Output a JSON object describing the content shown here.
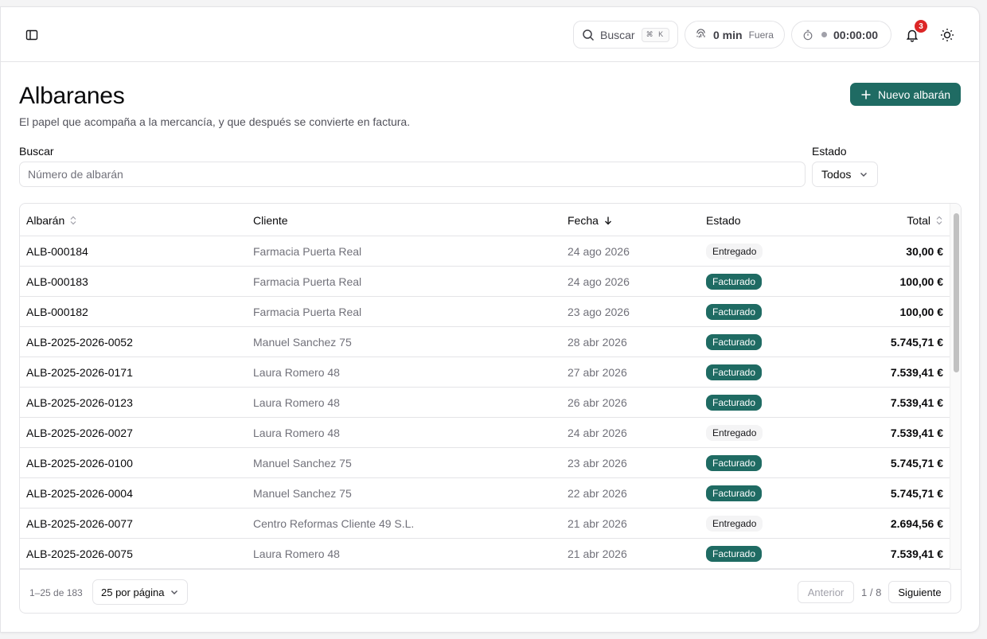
{
  "topbar": {
    "search_label": "Buscar",
    "search_shortcut": "⌘ K",
    "time_value": "0 min",
    "time_status": "Fuera",
    "timer_value": "00:00:00",
    "notifications_count": "3"
  },
  "page": {
    "title": "Albaranes",
    "subtitle": "El papel que acompaña a la mercancía, y que después se convierte en factura.",
    "new_button": "Nuevo albarán"
  },
  "filters": {
    "search_label": "Buscar",
    "search_placeholder": "Número de albarán",
    "estado_label": "Estado",
    "estado_value": "Todos"
  },
  "table": {
    "columns": {
      "albaran": "Albarán",
      "cliente": "Cliente",
      "fecha": "Fecha",
      "estado": "Estado",
      "total": "Total"
    },
    "rows": [
      {
        "id": "ALB-000184",
        "cliente": "Farmacia Puerta Real",
        "fecha": "24 ago 2026",
        "estado": "Entregado",
        "total": "30,00 €"
      },
      {
        "id": "ALB-000183",
        "cliente": "Farmacia Puerta Real",
        "fecha": "24 ago 2026",
        "estado": "Facturado",
        "total": "100,00 €"
      },
      {
        "id": "ALB-000182",
        "cliente": "Farmacia Puerta Real",
        "fecha": "23 ago 2026",
        "estado": "Facturado",
        "total": "100,00 €"
      },
      {
        "id": "ALB-2025-2026-0052",
        "cliente": "Manuel Sanchez 75",
        "fecha": "28 abr 2026",
        "estado": "Facturado",
        "total": "5.745,71 €"
      },
      {
        "id": "ALB-2025-2026-0171",
        "cliente": "Laura Romero 48",
        "fecha": "27 abr 2026",
        "estado": "Facturado",
        "total": "7.539,41 €"
      },
      {
        "id": "ALB-2025-2026-0123",
        "cliente": "Laura Romero 48",
        "fecha": "26 abr 2026",
        "estado": "Facturado",
        "total": "7.539,41 €"
      },
      {
        "id": "ALB-2025-2026-0027",
        "cliente": "Laura Romero 48",
        "fecha": "24 abr 2026",
        "estado": "Entregado",
        "total": "7.539,41 €"
      },
      {
        "id": "ALB-2025-2026-0100",
        "cliente": "Manuel Sanchez 75",
        "fecha": "23 abr 2026",
        "estado": "Facturado",
        "total": "5.745,71 €"
      },
      {
        "id": "ALB-2025-2026-0004",
        "cliente": "Manuel Sanchez 75",
        "fecha": "22 abr 2026",
        "estado": "Facturado",
        "total": "5.745,71 €"
      },
      {
        "id": "ALB-2025-2026-0077",
        "cliente": "Centro Reformas Cliente 49 S.L.",
        "fecha": "21 abr 2026",
        "estado": "Entregado",
        "total": "2.694,56 €"
      },
      {
        "id": "ALB-2025-2026-0075",
        "cliente": "Laura Romero 48",
        "fecha": "21 abr 2026",
        "estado": "Facturado",
        "total": "7.539,41 €"
      }
    ]
  },
  "pagination": {
    "range": "1–25 de 183",
    "per_page": "25 por página",
    "prev": "Anterior",
    "page_info": "1 / 8",
    "next": "Siguiente"
  },
  "colors": {
    "accent": "#1f6b63",
    "badge": "#dc2626"
  },
  "icons": [
    "sidebar-toggle-icon",
    "search-icon",
    "fingerprint-icon",
    "stopwatch-icon",
    "bell-icon",
    "sun-icon",
    "plus-icon",
    "chevron-down-icon",
    "sort-icon",
    "arrow-down-icon"
  ]
}
